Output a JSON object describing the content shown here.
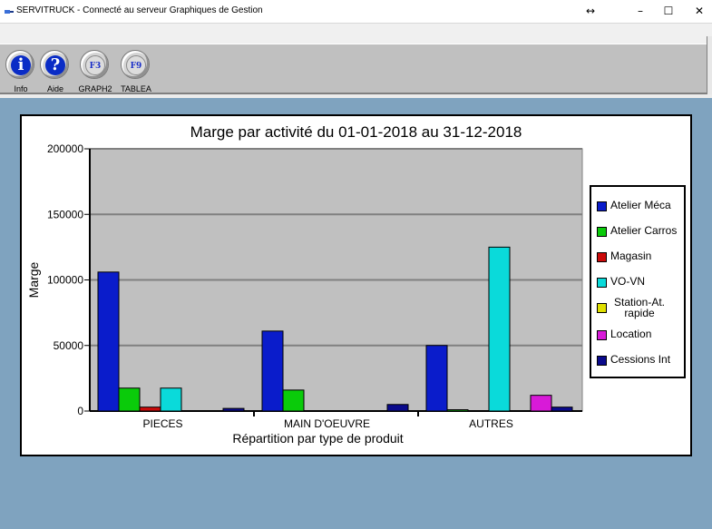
{
  "window": {
    "title": "SERVITRUCK - Connecté au serveur Graphiques de Gestion",
    "controls": [
      "↔",
      "–",
      "☐",
      "✕"
    ]
  },
  "toolbar": {
    "buttons": [
      {
        "label": "Info",
        "glyph": "i"
      },
      {
        "label": "Aide",
        "glyph": "?"
      },
      {
        "label": "GRAPH2",
        "glyph": "F3"
      },
      {
        "label": "TABLEA",
        "glyph": "F9"
      }
    ]
  },
  "colors": {
    "plot_bg": "#c0c0c0",
    "gridline": "#808080",
    "Atelier Méca": "#0a1ccb",
    "Atelier Carros": "#0acb0a",
    "Magasin": "#cb0a0a",
    "VO-VN": "#0adada",
    "Station-At. rapide": "#e0e000",
    "Location": "#d81ad8",
    "Cessions Int": "#0a0a8c"
  },
  "chart_data": {
    "type": "bar",
    "title": "Marge par activité du 01-01-2018 au 31-12-2018",
    "xlabel": "Répartition par type de produit",
    "ylabel": "Marge",
    "ylim": [
      0,
      200000
    ],
    "yticks": [
      0,
      50000,
      100000,
      150000,
      200000
    ],
    "ytick_labels": [
      "0",
      "50000",
      "100000",
      "150000",
      "200000"
    ],
    "grid": true,
    "legend_position": "right",
    "categories": [
      "PIECES",
      "MAIN D'OEUVRE",
      "AUTRES"
    ],
    "series": [
      {
        "name": "Atelier Méca",
        "values": [
          106000,
          61000,
          50000
        ]
      },
      {
        "name": "Atelier Carros",
        "values": [
          17500,
          16000,
          1000
        ]
      },
      {
        "name": "Magasin",
        "values": [
          3000,
          0,
          0
        ]
      },
      {
        "name": "VO-VN",
        "values": [
          17500,
          0,
          125000
        ]
      },
      {
        "name": "Station-At.\nrapide",
        "values": [
          0,
          0,
          0
        ]
      },
      {
        "name": "Location",
        "values": [
          0,
          0,
          12000
        ]
      },
      {
        "name": "Cessions Int",
        "values": [
          2000,
          5000,
          3000
        ]
      }
    ]
  }
}
